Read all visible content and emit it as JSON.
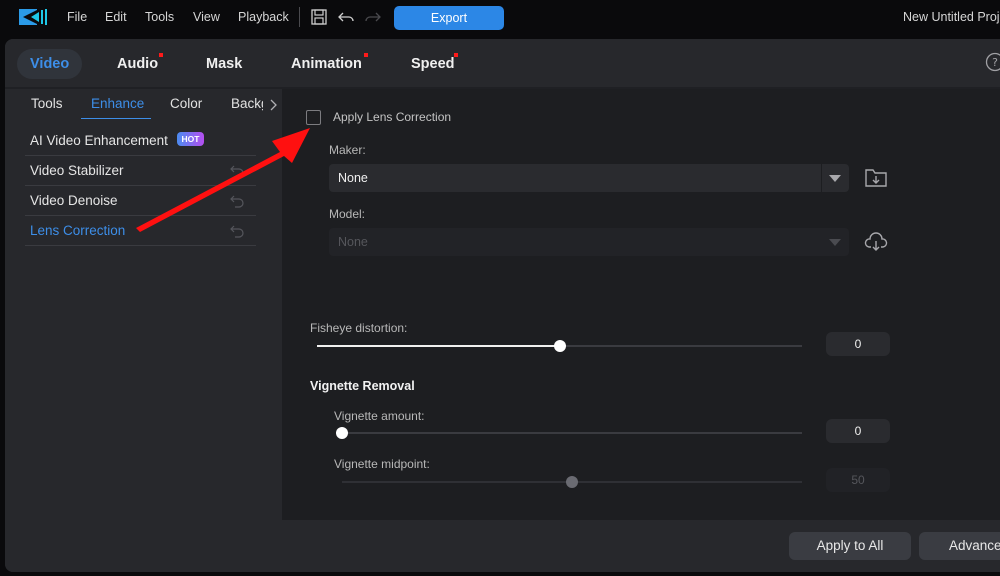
{
  "topbar": {
    "logo": "powerdirector-logo",
    "menus": [
      "File",
      "Edit",
      "Tools",
      "View",
      "Playback"
    ],
    "icons": [
      "save-icon",
      "undo-icon",
      "redo-icon"
    ],
    "export_label": "Export",
    "project_title": "New Untitled Proje"
  },
  "tabs": {
    "items": [
      {
        "label": "Video",
        "active": true,
        "dot": false
      },
      {
        "label": "Audio",
        "active": false,
        "dot": true
      },
      {
        "label": "Mask",
        "active": false,
        "dot": false
      },
      {
        "label": "Animation",
        "active": false,
        "dot": true
      },
      {
        "label": "Speed",
        "active": false,
        "dot": true
      }
    ],
    "help_icon": "help-circle-icon",
    "dot_color": "#ff1a1a",
    "active_color": "#3d8ee8"
  },
  "subtabs": {
    "items": [
      "Tools",
      "Enhance",
      "Color",
      "Backg"
    ],
    "active": "Enhance"
  },
  "enhance_list": [
    {
      "label": "AI Video Enhancement",
      "badge": "HOT",
      "reset": false,
      "active": false
    },
    {
      "label": "Video Stabilizer",
      "reset": true,
      "active": false
    },
    {
      "label": "Video Denoise",
      "reset": true,
      "active": false
    },
    {
      "label": "Lens Correction",
      "reset": true,
      "active": true
    }
  ],
  "lens": {
    "apply_label": "Apply Lens Correction",
    "apply_checked": false,
    "maker_label": "Maker:",
    "maker_value": "None",
    "model_label": "Model:",
    "model_value": "None",
    "fisheye_label": "Fisheye distortion:",
    "fisheye_value": "0",
    "fisheye_fraction": 0.5,
    "vignette_title": "Vignette Removal",
    "vig_amount_label": "Vignette amount:",
    "vig_amount_value": "0",
    "vig_amount_fraction": 0.0,
    "vig_mid_label": "Vignette midpoint:",
    "vig_mid_value": "50",
    "vig_mid_fraction": 0.5
  },
  "footer": {
    "apply_all_label": "Apply to All",
    "advanced_label": "Advanced"
  },
  "annotation": {
    "arrow_color": "#ff1010"
  }
}
